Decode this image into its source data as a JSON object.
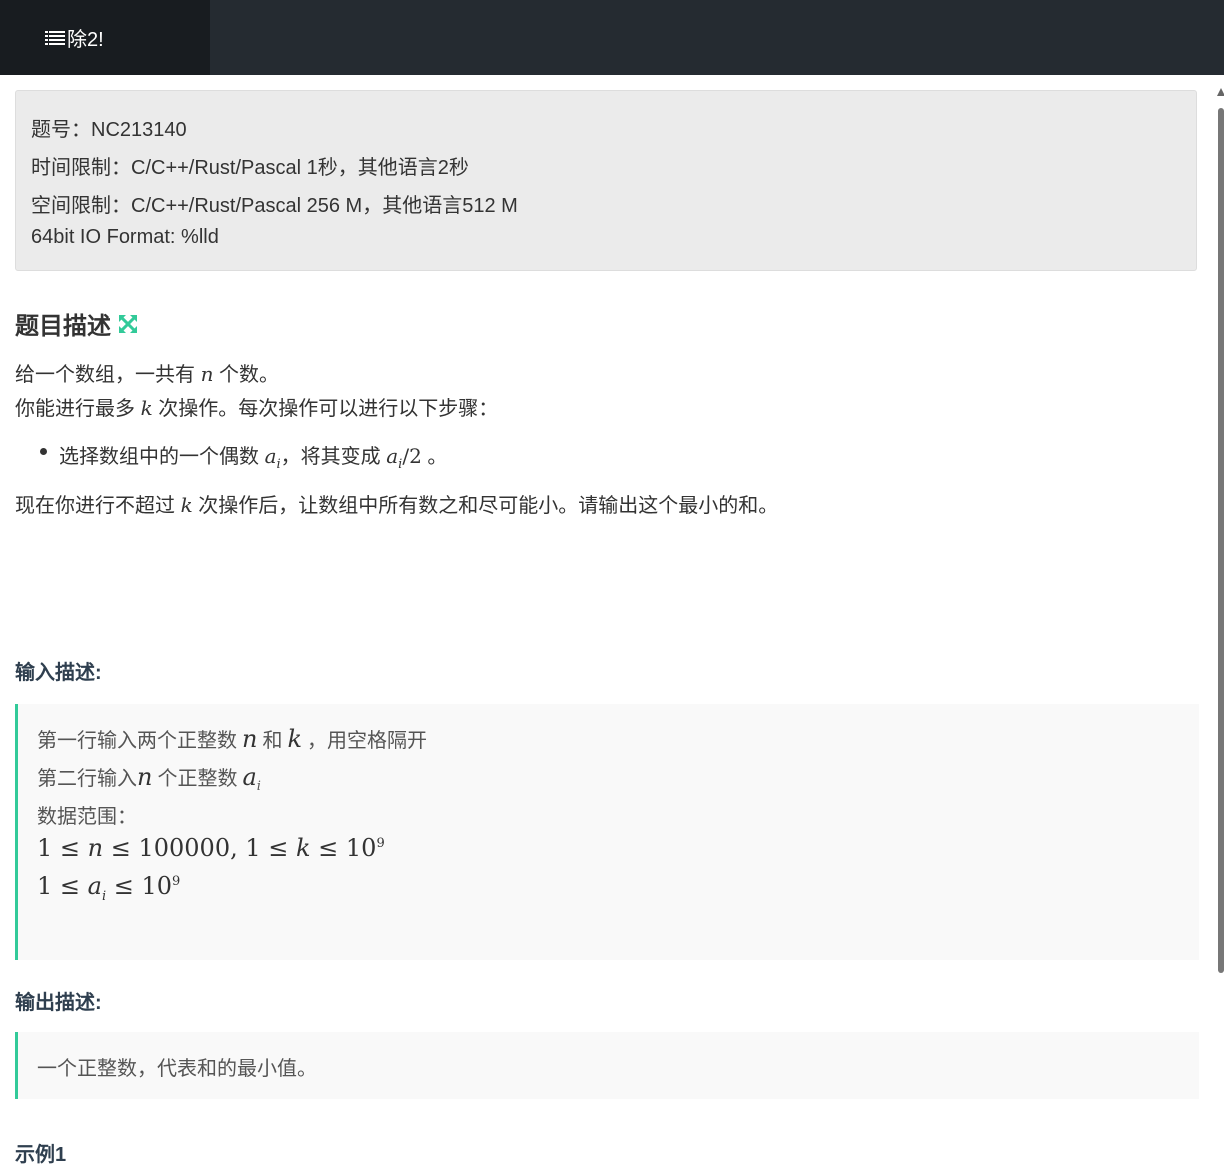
{
  "tab": {
    "title": "除2!"
  },
  "info": {
    "id_line": "题号：NC213140",
    "time_line": "时间限制：C/C++/Rust/Pascal 1秒，其他语言2秒",
    "memory_line": "空间限制：C/C++/Rust/Pascal 256 M，其他语言512 M",
    "format_line": "64bit IO Format: %lld"
  },
  "description": {
    "heading": "题目描述",
    "p1_a": "给一个数组，一共有 ",
    "p1_var": "n",
    "p1_b": " 个数。",
    "p2_a": "你能进行最多 ",
    "p2_var": "k",
    "p2_b": " 次操作。每次操作可以进行以下步骤：",
    "bullet_a": "选择数组中的一个偶数 ",
    "bullet_var": "a",
    "bullet_sub": "i",
    "bullet_b": "，将其变成 ",
    "bullet_var2": "a",
    "bullet_sub2": "i",
    "bullet_div": "/2",
    "bullet_c": " 。",
    "p3_a": "现在你进行不超过 ",
    "p3_var": "k",
    "p3_b": " 次操作后，让数组中所有数之和尽可能小。请输出这个最小的和。"
  },
  "input": {
    "heading": "输入描述:",
    "l1_a": "第一行输入两个正整数 ",
    "l1_n": "n",
    "l1_mid": " 和 ",
    "l1_k": "k",
    "l1_b": " ，用空格隔开",
    "l2_a": "第二行输入",
    "l2_n": "n",
    "l2_b": " 个正整数 ",
    "l2_a_var": "a",
    "l2_sub": "i",
    "l3": "数据范围：",
    "l4_a": "1 ≤ ",
    "l4_n": "n",
    "l4_b": " ≤ 100000,  1 ≤ ",
    "l4_k": "k",
    "l4_c": " ≤ 10",
    "l4_exp": "9",
    "l5_a": "1 ≤ ",
    "l5_var": "a",
    "l5_sub": "i",
    "l5_b": " ≤ 10",
    "l5_exp": "9"
  },
  "output": {
    "heading": "输出描述:",
    "text": "一个正整数，代表和的最小值。"
  },
  "example": {
    "heading": "示例1"
  }
}
